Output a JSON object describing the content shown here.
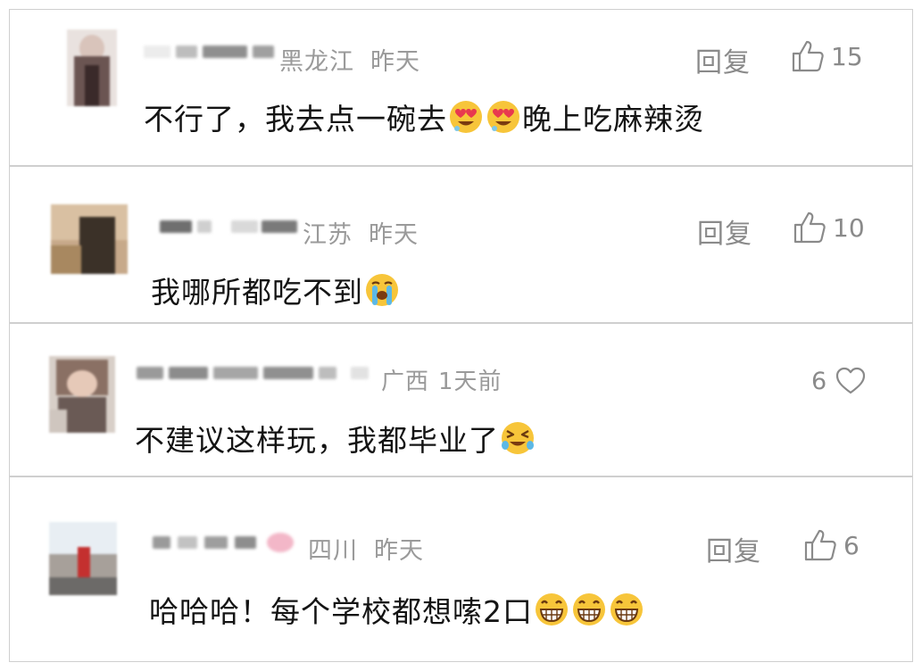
{
  "comments": [
    {
      "region": "黑龙江",
      "time": "昨天",
      "reply_label": "回复",
      "likes": "15",
      "text_before": "不行了，我去点一碗去",
      "text_after": "晚上吃麻辣烫",
      "emojis": [
        "heart-eyes-emoji",
        "heart-eyes-emoji"
      ]
    },
    {
      "region": "江苏",
      "time": "昨天",
      "reply_label": "回复",
      "likes": "10",
      "text_before": "我哪所都吃不到",
      "text_after": "",
      "emojis": [
        "loudly-crying-emoji"
      ]
    },
    {
      "region": "广西",
      "time": "1天前",
      "likes": "6",
      "text_before": "不建议这样玩，我都毕业了",
      "text_after": "",
      "emojis": [
        "laughing-tears-emoji"
      ]
    },
    {
      "region": "四川",
      "time": "昨天",
      "reply_label": "回复",
      "likes": "6",
      "text_before": "哈哈哈！每个学校都想嗦2口",
      "text_after": "",
      "emojis": [
        "grinning-emoji",
        "grinning-emoji",
        "grinning-emoji"
      ]
    }
  ],
  "colors": {
    "text": "#141414",
    "meta": "#9a9a9a",
    "divider": "#cfcfcf",
    "emoji_face": "#f7c53a"
  }
}
